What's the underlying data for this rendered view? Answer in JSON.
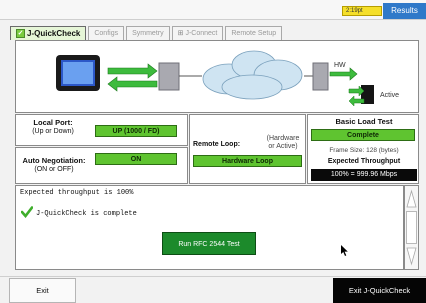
{
  "status": {
    "time": "2:19pt"
  },
  "header": {
    "results_label": "Results"
  },
  "tabs": [
    {
      "label": "J-QuickCheck",
      "active": true
    },
    {
      "label": "Configs",
      "active": false
    },
    {
      "label": "Symmetry",
      "active": false
    },
    {
      "label": "J-Connect",
      "active": false
    },
    {
      "label": "Remote Setup",
      "active": false
    }
  ],
  "diagram": {
    "hw_label": "HW",
    "active_label": "Active"
  },
  "local_port": {
    "title": "Local Port:",
    "subtitle": "(Up or Down)",
    "value": "UP (1000 / FD)"
  },
  "auto_negotiation": {
    "title": "Auto Negotiation:",
    "subtitle": "(ON or OFF)",
    "value": "ON"
  },
  "remote_loop": {
    "title": "Remote Loop:",
    "hint_line1": "(Hardware",
    "hint_line2": "or Active)",
    "value": "Hardware Loop"
  },
  "basic_load_test": {
    "title": "Basic Load Test",
    "status": "Complete",
    "frame_size": "Frame Size: 128 (bytes)",
    "expected_label": "Expected Throughput",
    "expected_value": "100% = 999.96 Mbps"
  },
  "log": {
    "line1": "Expected throughput is 100%",
    "line2": "J-QuickCheck is complete"
  },
  "actions": {
    "run_rfc": "Run RFC 2544 Test",
    "exit": "Exit",
    "exit_quickcheck": "Exit J-QuickCheck"
  },
  "icons": {
    "check": "checkmark-icon",
    "tester": "tester-device-icon",
    "cloud": "network-cloud-icon",
    "loop": "loop-arrows-icon",
    "cursor": "mouse-pointer-icon"
  },
  "colors": {
    "status_green": "#5fc430",
    "run_button_green": "#1c8a2b",
    "results_blue": "#2f79c9",
    "time_yellow": "#f5df2a"
  }
}
